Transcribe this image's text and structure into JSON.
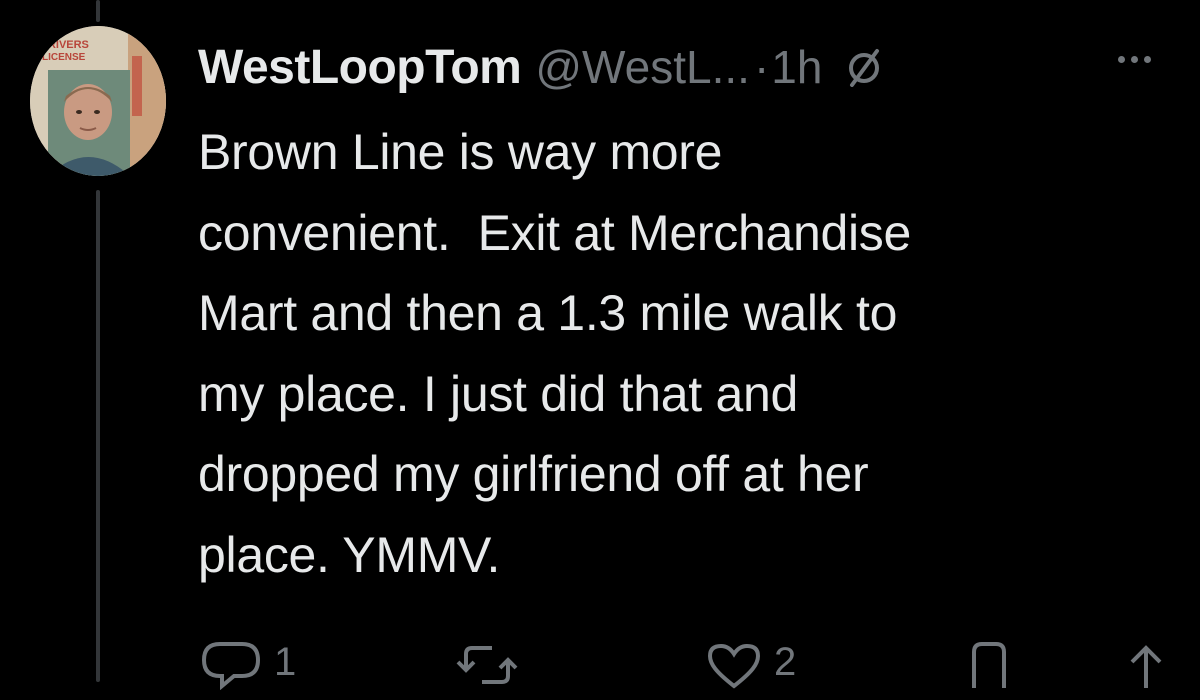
{
  "tweet": {
    "display_name": "WestLoopTom",
    "handle": "@WestL...",
    "separator": "·",
    "time": "1h",
    "avatar_text": {
      "line1": "DRIVERS",
      "line2": "LICENSE"
    },
    "text": "Brown Line is way more\nconvenient.  Exit at Merchandise\nMart and then a 1.3 mile walk to\nmy place. I just did that and\ndropped my girlfriend off at her\nplace. YMMV."
  },
  "actions": {
    "reply_count": "1",
    "retweet_count": "",
    "like_count": "2"
  },
  "icons": {
    "muted": "muted-icon",
    "more": "more-options-icon",
    "reply": "reply-icon",
    "retweet": "retweet-icon",
    "like": "heart-icon",
    "bookmark": "bookmark-icon",
    "share": "share-icon"
  },
  "colors": {
    "background": "#000000",
    "text_primary": "#e7e9ea",
    "text_secondary": "#71767b",
    "thread_line": "#333639"
  }
}
